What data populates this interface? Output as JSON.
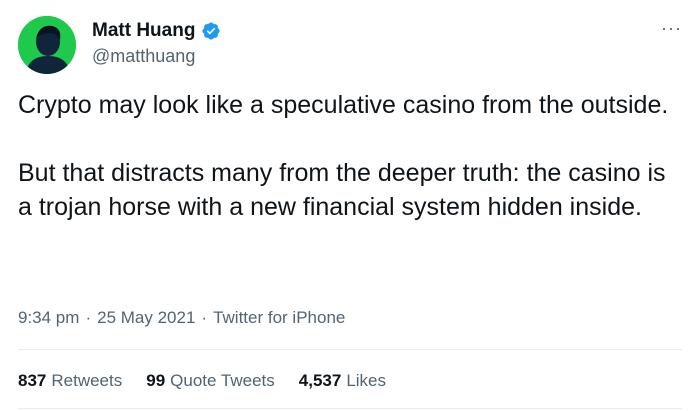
{
  "author": {
    "name": "Matt Huang",
    "handle": "@matthuang",
    "avatar_color": "#1ec94c",
    "verified_color": "#1d9bf0"
  },
  "tweet": {
    "paragraphs": [
      "Crypto may look like a speculative casino from the outside.",
      "But that distracts many from the deeper truth: the casino is a trojan horse with a new financial system hidden inside."
    ],
    "time": "9:34 pm",
    "date": "25 May 2021",
    "source": "Twitter for iPhone",
    "separator": "·"
  },
  "stats": {
    "retweets_count": "837",
    "retweets_label": "Retweets",
    "quotes_count": "99",
    "quotes_label": "Quote Tweets",
    "likes_count": "4,537",
    "likes_label": "Likes"
  },
  "menu_icon": "more-icon",
  "more_glyph": "···"
}
